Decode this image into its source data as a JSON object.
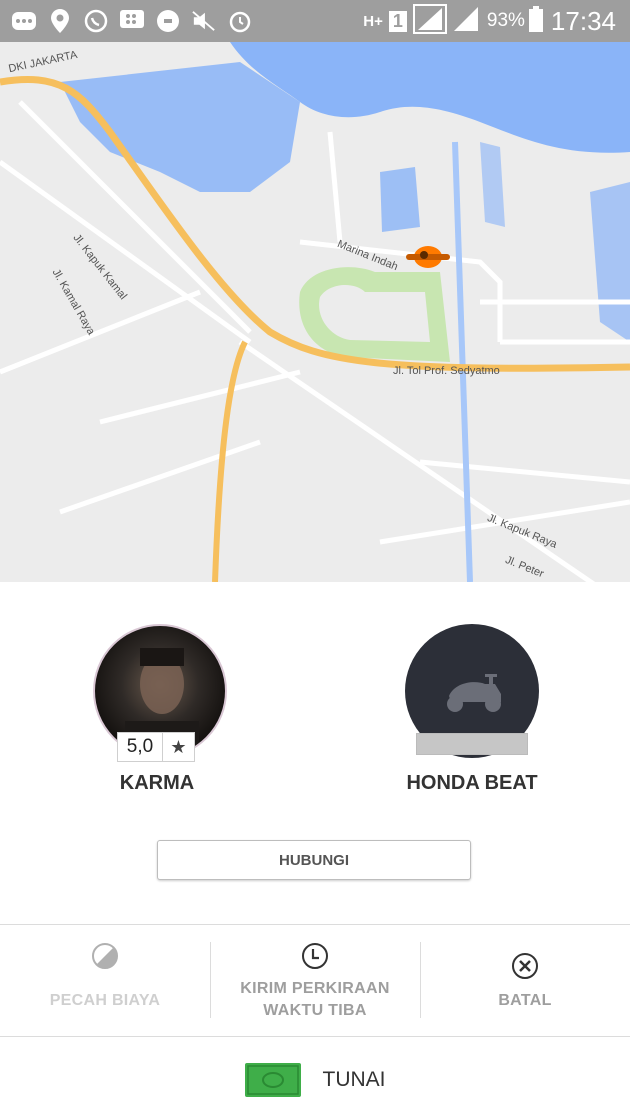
{
  "status_bar": {
    "icons": [
      "more-icon",
      "location-icon",
      "whatsapp-icon",
      "bbm-icon",
      "uber-icon",
      "mute-icon",
      "alarm-icon"
    ],
    "network": "H+",
    "sim": "1",
    "battery": "93%",
    "time": "17:34"
  },
  "map": {
    "labels": {
      "region": "DKI JAKARTA",
      "kapuk_kamal": "Jl. Kapuk Kamal",
      "kamal_raya": "Jl. Kamal Raya",
      "marina": "Marina Indah",
      "tol": "Jl. Tol Prof. Sedyatmo",
      "kapuk_raya": "Jl. Kapuk Raya",
      "peter": "Jl. Peter"
    },
    "colors": {
      "water": "#8ab4f8",
      "road_major": "#f6bf5d",
      "park": "#c8e6b1",
      "land": "#ececec"
    }
  },
  "driver": {
    "name": "KARMA",
    "rating": "5,0",
    "rating_icon": "star-icon"
  },
  "vehicle": {
    "name": "HONDA BEAT",
    "icon": "scooter-icon"
  },
  "contact_button": "HUBUNGI",
  "actions": [
    {
      "label": "PECAH BIAYA",
      "icon": "split-fare-icon",
      "color": "#cfcfcf"
    },
    {
      "label": "KIRIM PERKIRAAN WAKTU TIBA",
      "icon": "clock-icon",
      "color": "#9e9e9e"
    },
    {
      "label": "BATAL",
      "icon": "cancel-icon",
      "color": "#9e9e9e"
    }
  ],
  "payment": {
    "label": "TUNAI",
    "icon": "cash-icon",
    "color": "#3fae49"
  }
}
